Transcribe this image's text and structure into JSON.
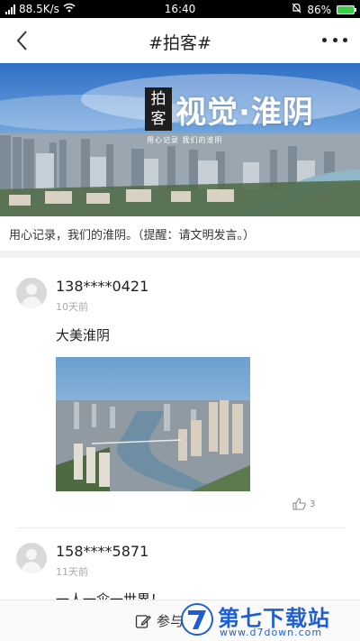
{
  "status_bar": {
    "speed": "88.5K/s",
    "time": "16:40",
    "battery": "86%"
  },
  "nav": {
    "title": "#拍客#"
  },
  "banner": {
    "tag_line1": "拍",
    "tag_line2": "客",
    "title": "视觉·淮阴",
    "subtitle": "用心记录  我们的淮阴"
  },
  "description": "用心记录，我们的淮阴。（提醒：请文明发言。）",
  "posts": [
    {
      "user": "138****0421",
      "time": "10天前",
      "text": "大美淮阴",
      "likes": "3"
    },
    {
      "user": "158****5871",
      "time": "11天前",
      "text": "一人一伞一世界！"
    }
  ],
  "bottom_bar": {
    "join_label": "参与互动"
  },
  "watermark": {
    "title": "第七下载站",
    "url": "www.d7down.com"
  },
  "colors": {
    "battery": "#3bd04a",
    "watermark": "#1f5fd4"
  }
}
